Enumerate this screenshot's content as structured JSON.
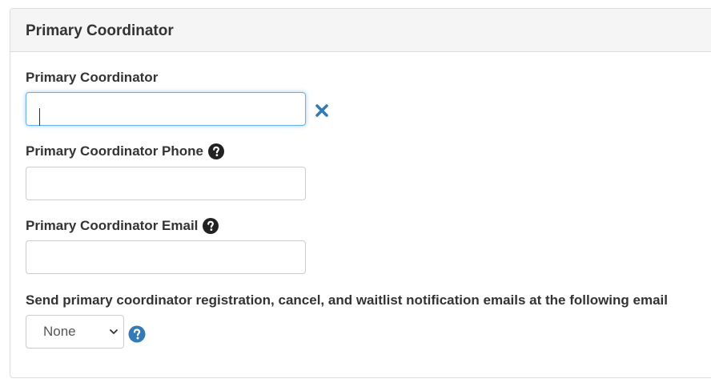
{
  "panel": {
    "title": "Primary Coordinator"
  },
  "fields": {
    "coordinator": {
      "label": "Primary Coordinator",
      "value": ""
    },
    "phone": {
      "label": "Primary Coordinator Phone",
      "value": ""
    },
    "email": {
      "label": "Primary Coordinator Email",
      "value": ""
    },
    "notification": {
      "label": "Send primary coordinator registration, cancel, and waitlist notification emails at the following email",
      "selected": "None"
    }
  },
  "icons": {
    "clear": "close-icon",
    "help": "question-circle-icon"
  },
  "colors": {
    "accent_blue": "#337ab7",
    "focus_border": "#66afe9",
    "help_dark": "#222222"
  }
}
